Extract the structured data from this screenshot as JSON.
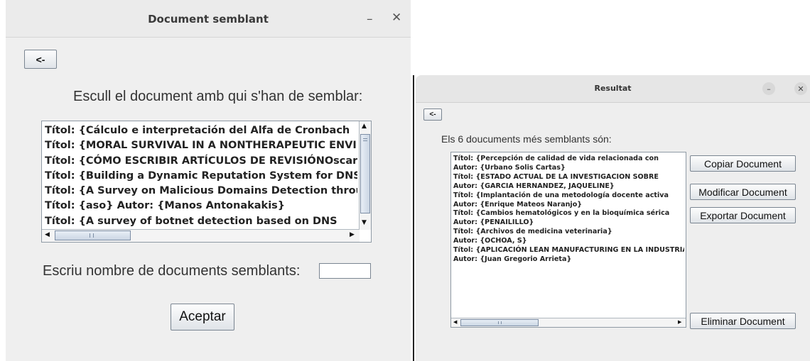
{
  "win1": {
    "title": "Document semblant",
    "minimize_glyph": "–",
    "close_glyph": "✕",
    "back_label": "<-",
    "prompt": "Escull el document amb qui s'han de semblar:",
    "documents": [
      "Títol: {Cálculo e interpretación del Alfa de Cronbach",
      "Títol: {MORAL SURVIVAL IN A NONTHERAPEUTIC ENVIRONMENT",
      "Títol: {CÓMO ESCRIBIR ARTÍCULOS DE REVISIÓNOscar",
      "Títol: {Building a Dynamic Reputation System for DNS",
      "Títol: {A Survey on Malicious Domains Detection through",
      "Títol: {aso}  Autor: {Manos Antonakakis}",
      "Títol: {A survey of botnet detection based on DNS"
    ],
    "count_label": "Escriu nombre de documents semblants:",
    "count_value": "",
    "accept_label": "Aceptar",
    "icons": {
      "scroll_up": "up-arrow-icon",
      "scroll_down": "down-arrow-icon",
      "scroll_left": "left-arrow-icon",
      "scroll_right": "right-arrow-icon"
    }
  },
  "win2": {
    "title": "Resultat",
    "minimize_glyph": "–",
    "close_glyph": "✕",
    "back_label": "<-",
    "info": "Els 6 doucuments més semblants són:",
    "results": [
      "Títol: {Percepción de calidad de vida relacionada con",
      "Autor: {Urbano Solis Cartas}",
      "Títol: {ESTADO ACTUAL DE LA INVESTIGACION SOBRE",
      "Autor: {GARCIA HERNANDEZ, JAQUELINE}",
      "Títol: {Implantación de una metodología docente activa",
      "Autor: {Enrique Mateos Naranjo}",
      "Títol: {Cambios hematológicos y en la bioquímica sérica",
      "Autor: {PENAILILLO}",
      "Títol: {Archivos de medicina veterinaria}",
      "Autor: {OCHOA, S}",
      "Títol: {APLICACIÓN LEAN MANUFACTURING EN LA INDUSTRIA",
      "Autor: {Juan Gregorio Arrieta}"
    ],
    "buttons": {
      "copy": "Copiar Document",
      "modify": "Modificar Document",
      "export": "Exportar Document",
      "delete": "Eliminar Document"
    }
  }
}
